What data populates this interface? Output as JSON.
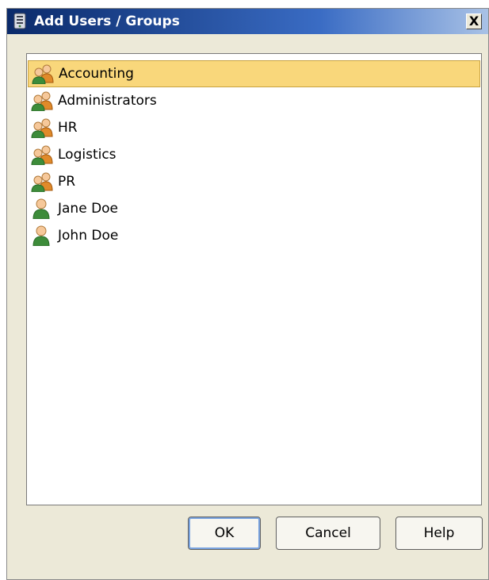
{
  "window": {
    "title": "Add Users / Groups",
    "close_label": "X"
  },
  "list": {
    "items": [
      {
        "label": "Accounting",
        "kind": "group",
        "icon": "group-icon",
        "selected": true
      },
      {
        "label": "Administrators",
        "kind": "group",
        "icon": "group-icon",
        "selected": false
      },
      {
        "label": "HR",
        "kind": "group",
        "icon": "group-icon",
        "selected": false
      },
      {
        "label": "Logistics",
        "kind": "group",
        "icon": "group-icon",
        "selected": false
      },
      {
        "label": "PR",
        "kind": "group",
        "icon": "group-icon",
        "selected": false
      },
      {
        "label": "Jane Doe",
        "kind": "user",
        "icon": "user-icon",
        "selected": false
      },
      {
        "label": "John Doe",
        "kind": "user",
        "icon": "user-icon",
        "selected": false
      }
    ]
  },
  "buttons": {
    "ok": "OK",
    "cancel": "Cancel",
    "help": "Help"
  },
  "colors": {
    "selection": "#f9d77b",
    "titlebar_start": "#0a2a6a",
    "titlebar_end": "#a9c2e6",
    "dialog_bg": "#ece9d8"
  }
}
